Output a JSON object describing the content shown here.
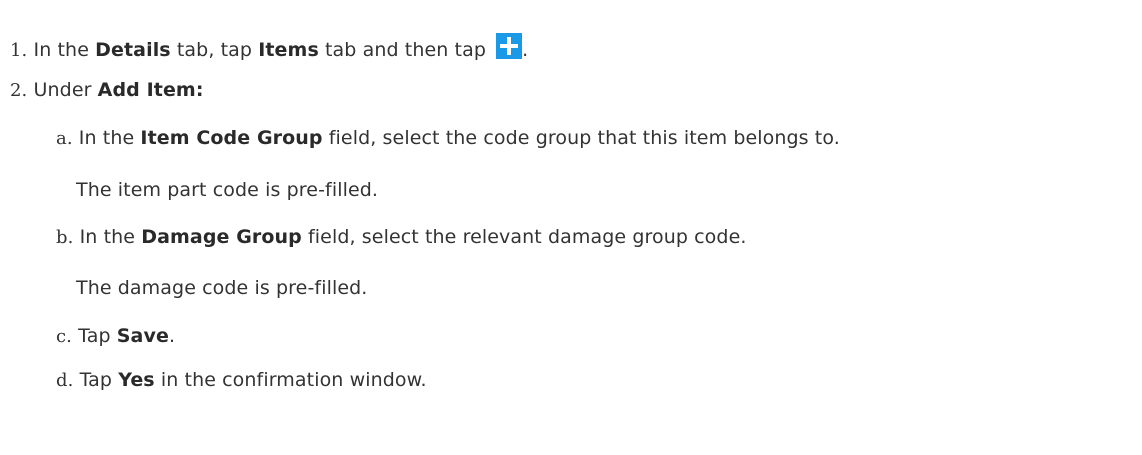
{
  "steps": [
    {
      "number": "1.",
      "prefix": "In the ",
      "details": "Details",
      "mid1": " tab, tap ",
      "items": "Items",
      "mid2": " tab and then tap ",
      "end": ".",
      "icon": "plus-icon"
    },
    {
      "number": "2.",
      "prefix": "Under ",
      "bold": "Add Item:"
    }
  ],
  "substeps": [
    {
      "letter": "a.",
      "prefix": "In the ",
      "bold": "Item Code Group",
      "suffix": " field, select the code group that this item belongs to.",
      "note": "The item part code is pre-filled."
    },
    {
      "letter": "b.",
      "prefix": "In the ",
      "bold": "Damage Group",
      "suffix": " field, select the relevant damage group code.",
      "note": "The damage code is pre-filled."
    },
    {
      "letter": "c.",
      "prefix": "Tap ",
      "bold": "Save",
      "suffix": "."
    },
    {
      "letter": "d.",
      "prefix": "Tap ",
      "bold": "Yes",
      "suffix": " in the confirmation window."
    }
  ],
  "colors": {
    "text": "#333333",
    "icon_bg": "#1a9ae6"
  }
}
